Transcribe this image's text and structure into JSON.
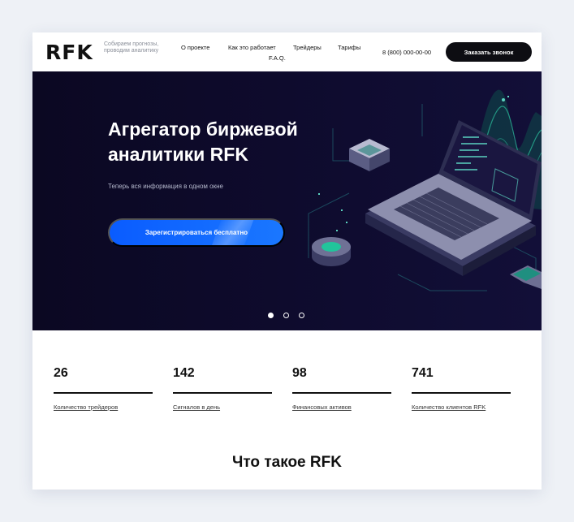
{
  "header": {
    "logo": "RFK",
    "tagline": "Собираем прогнозы, проводим аналитику",
    "nav": [
      "О проекте",
      "Как это работает",
      "Трейдеры",
      "Тарифы",
      "F.A.Q."
    ],
    "phone": "8 (800) 000-00-00",
    "call_button": "Заказать звонок"
  },
  "hero": {
    "title": "Агрегатор биржевой аналитики RFK",
    "subtitle": "Теперь вся информация в одном окне",
    "cta": "Зарегистрироваться бесплатно",
    "slides_total": 3,
    "slide_active": 1
  },
  "stats": [
    {
      "value": "26",
      "label": "Количество трейдеров"
    },
    {
      "value": "142",
      "label": "Сигналов в день"
    },
    {
      "value": "98",
      "label": "Финансовых активов"
    },
    {
      "value": "741",
      "label": "Количество клиентов RFK"
    }
  ],
  "section": {
    "title": "Что такое RFK"
  },
  "colors": {
    "accent": "#0a5cff",
    "hero_bg": "#0e0b2d",
    "button_dark": "#0d0d12"
  }
}
